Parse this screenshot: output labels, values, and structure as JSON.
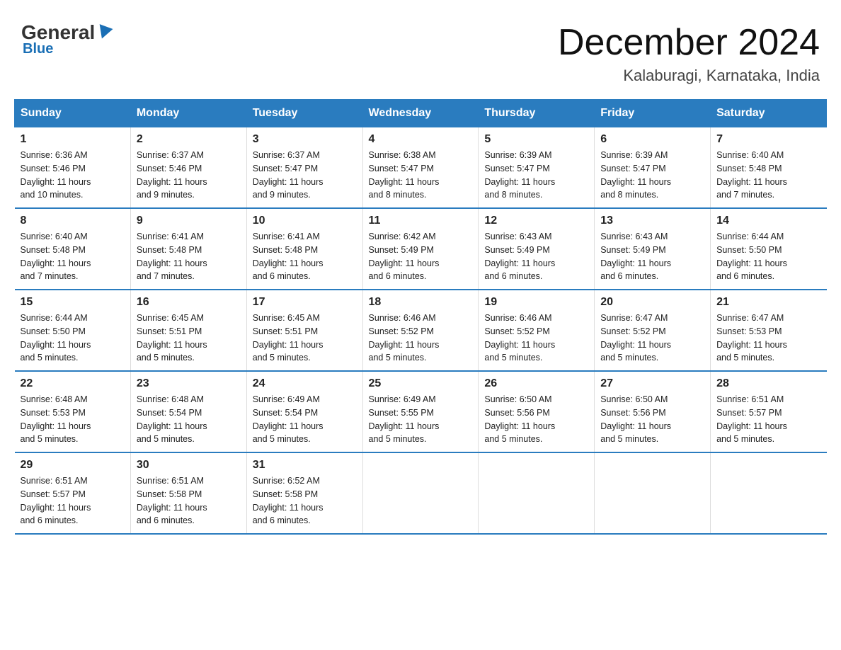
{
  "logo": {
    "general": "General",
    "blue": "Blue"
  },
  "title": "December 2024",
  "subtitle": "Kalaburagi, Karnataka, India",
  "days": [
    "Sunday",
    "Monday",
    "Tuesday",
    "Wednesday",
    "Thursday",
    "Friday",
    "Saturday"
  ],
  "weeks": [
    [
      {
        "day": "1",
        "sunrise": "6:36 AM",
        "sunset": "5:46 PM",
        "daylight": "11 hours and 10 minutes."
      },
      {
        "day": "2",
        "sunrise": "6:37 AM",
        "sunset": "5:46 PM",
        "daylight": "11 hours and 9 minutes."
      },
      {
        "day": "3",
        "sunrise": "6:37 AM",
        "sunset": "5:47 PM",
        "daylight": "11 hours and 9 minutes."
      },
      {
        "day": "4",
        "sunrise": "6:38 AM",
        "sunset": "5:47 PM",
        "daylight": "11 hours and 8 minutes."
      },
      {
        "day": "5",
        "sunrise": "6:39 AM",
        "sunset": "5:47 PM",
        "daylight": "11 hours and 8 minutes."
      },
      {
        "day": "6",
        "sunrise": "6:39 AM",
        "sunset": "5:47 PM",
        "daylight": "11 hours and 8 minutes."
      },
      {
        "day": "7",
        "sunrise": "6:40 AM",
        "sunset": "5:48 PM",
        "daylight": "11 hours and 7 minutes."
      }
    ],
    [
      {
        "day": "8",
        "sunrise": "6:40 AM",
        "sunset": "5:48 PM",
        "daylight": "11 hours and 7 minutes."
      },
      {
        "day": "9",
        "sunrise": "6:41 AM",
        "sunset": "5:48 PM",
        "daylight": "11 hours and 7 minutes."
      },
      {
        "day": "10",
        "sunrise": "6:41 AM",
        "sunset": "5:48 PM",
        "daylight": "11 hours and 6 minutes."
      },
      {
        "day": "11",
        "sunrise": "6:42 AM",
        "sunset": "5:49 PM",
        "daylight": "11 hours and 6 minutes."
      },
      {
        "day": "12",
        "sunrise": "6:43 AM",
        "sunset": "5:49 PM",
        "daylight": "11 hours and 6 minutes."
      },
      {
        "day": "13",
        "sunrise": "6:43 AM",
        "sunset": "5:49 PM",
        "daylight": "11 hours and 6 minutes."
      },
      {
        "day": "14",
        "sunrise": "6:44 AM",
        "sunset": "5:50 PM",
        "daylight": "11 hours and 6 minutes."
      }
    ],
    [
      {
        "day": "15",
        "sunrise": "6:44 AM",
        "sunset": "5:50 PM",
        "daylight": "11 hours and 5 minutes."
      },
      {
        "day": "16",
        "sunrise": "6:45 AM",
        "sunset": "5:51 PM",
        "daylight": "11 hours and 5 minutes."
      },
      {
        "day": "17",
        "sunrise": "6:45 AM",
        "sunset": "5:51 PM",
        "daylight": "11 hours and 5 minutes."
      },
      {
        "day": "18",
        "sunrise": "6:46 AM",
        "sunset": "5:52 PM",
        "daylight": "11 hours and 5 minutes."
      },
      {
        "day": "19",
        "sunrise": "6:46 AM",
        "sunset": "5:52 PM",
        "daylight": "11 hours and 5 minutes."
      },
      {
        "day": "20",
        "sunrise": "6:47 AM",
        "sunset": "5:52 PM",
        "daylight": "11 hours and 5 minutes."
      },
      {
        "day": "21",
        "sunrise": "6:47 AM",
        "sunset": "5:53 PM",
        "daylight": "11 hours and 5 minutes."
      }
    ],
    [
      {
        "day": "22",
        "sunrise": "6:48 AM",
        "sunset": "5:53 PM",
        "daylight": "11 hours and 5 minutes."
      },
      {
        "day": "23",
        "sunrise": "6:48 AM",
        "sunset": "5:54 PM",
        "daylight": "11 hours and 5 minutes."
      },
      {
        "day": "24",
        "sunrise": "6:49 AM",
        "sunset": "5:54 PM",
        "daylight": "11 hours and 5 minutes."
      },
      {
        "day": "25",
        "sunrise": "6:49 AM",
        "sunset": "5:55 PM",
        "daylight": "11 hours and 5 minutes."
      },
      {
        "day": "26",
        "sunrise": "6:50 AM",
        "sunset": "5:56 PM",
        "daylight": "11 hours and 5 minutes."
      },
      {
        "day": "27",
        "sunrise": "6:50 AM",
        "sunset": "5:56 PM",
        "daylight": "11 hours and 5 minutes."
      },
      {
        "day": "28",
        "sunrise": "6:51 AM",
        "sunset": "5:57 PM",
        "daylight": "11 hours and 5 minutes."
      }
    ],
    [
      {
        "day": "29",
        "sunrise": "6:51 AM",
        "sunset": "5:57 PM",
        "daylight": "11 hours and 6 minutes."
      },
      {
        "day": "30",
        "sunrise": "6:51 AM",
        "sunset": "5:58 PM",
        "daylight": "11 hours and 6 minutes."
      },
      {
        "day": "31",
        "sunrise": "6:52 AM",
        "sunset": "5:58 PM",
        "daylight": "11 hours and 6 minutes."
      },
      null,
      null,
      null,
      null
    ]
  ],
  "labels": {
    "sunrise": "Sunrise:",
    "sunset": "Sunset:",
    "daylight": "Daylight:"
  }
}
